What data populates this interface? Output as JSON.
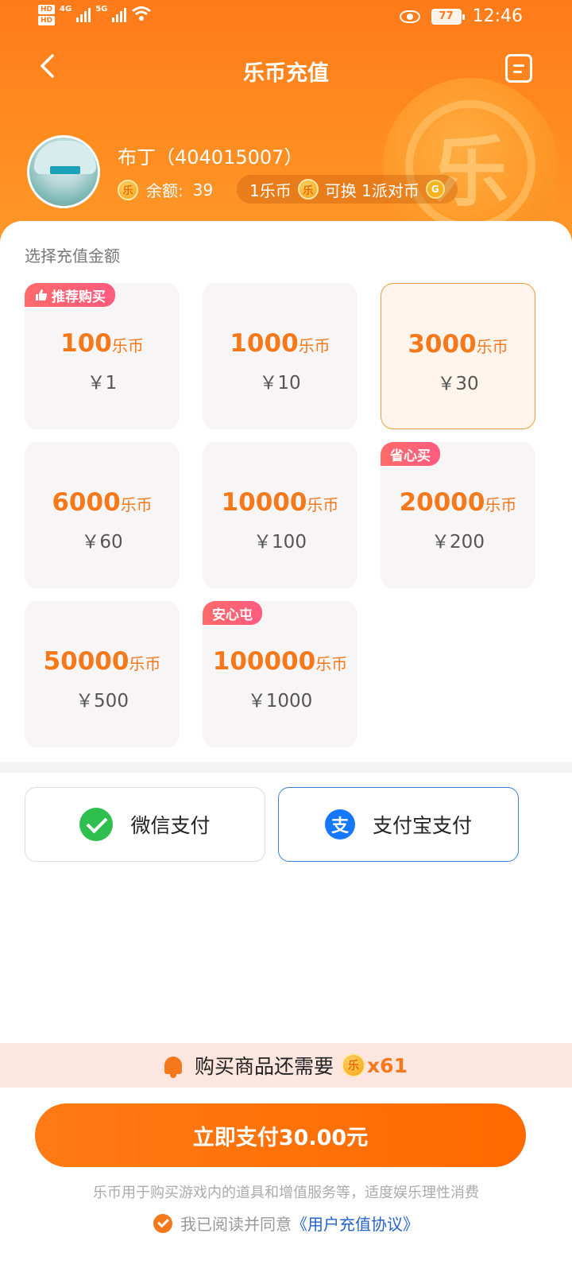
{
  "status_bar": {
    "time": "12:46",
    "battery": "77",
    "hd1": "HD",
    "hd2": "HD",
    "net1": "4G",
    "net2": "5G"
  },
  "header": {
    "title": "乐币充值"
  },
  "profile": {
    "name": "布丁（404015007）",
    "balance_label": "余额:",
    "balance": "39",
    "rate_left": "1乐币",
    "rate_mid": "可换 1派对币",
    "coin_glyph": "乐",
    "g_glyph": "G"
  },
  "section": {
    "label": "选择充值金额"
  },
  "amounts": [
    {
      "coins": "100",
      "unit": "乐币",
      "price": "￥1",
      "badge": "推荐购买"
    },
    {
      "coins": "1000",
      "unit": "乐币",
      "price": "￥10",
      "badge": ""
    },
    {
      "coins": "3000",
      "unit": "乐币",
      "price": "￥30",
      "badge": ""
    },
    {
      "coins": "6000",
      "unit": "乐币",
      "price": "￥60",
      "badge": ""
    },
    {
      "coins": "10000",
      "unit": "乐币",
      "price": "￥100",
      "badge": ""
    },
    {
      "coins": "20000",
      "unit": "乐币",
      "price": "￥200",
      "badge": "省心买"
    },
    {
      "coins": "50000",
      "unit": "乐币",
      "price": "￥500",
      "badge": ""
    },
    {
      "coins": "100000",
      "unit": "乐币",
      "price": "￥1000",
      "badge": "安心屯"
    }
  ],
  "payment": {
    "wechat": "微信支付",
    "alipay": "支付宝支付",
    "alipay_glyph": "支"
  },
  "notice": {
    "text": "购买商品还需要",
    "mult": "x61"
  },
  "pay_button": {
    "label": "立即支付30.00元"
  },
  "footer": {
    "note": "乐币用于购买游戏内的道具和增值服务等，适度娱乐理性消费",
    "agree_prefix": "我已阅读并同意",
    "agree_link": "《用户充值协议》"
  },
  "colors": {
    "accent": "#ff7a1a",
    "selected_border": "#f29a3e",
    "badge": "#ff5b7f",
    "alipay": "#1677ff",
    "wechat": "#2fbf4f",
    "link": "#2563c9"
  }
}
